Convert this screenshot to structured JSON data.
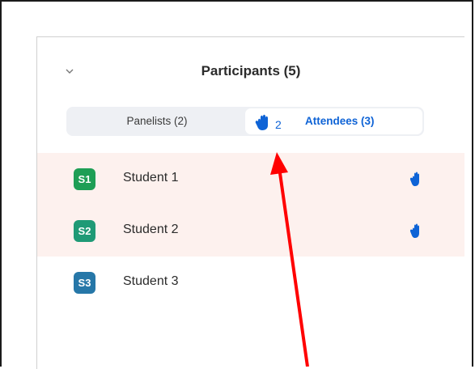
{
  "header": {
    "title": "Participants (5)",
    "collapse_icon": "chevron-down-icon"
  },
  "tabs": {
    "panelists": {
      "label": "Panelists (2)"
    },
    "attendees": {
      "label": "Attendees (3)",
      "raised_hands_count": "2",
      "icon": "raised-hand-icon"
    }
  },
  "attendees": [
    {
      "initials": "S1",
      "name": "Student 1",
      "avatar_color": "#1e9e55",
      "hand_raised": true
    },
    {
      "initials": "S2",
      "name": "Student 2",
      "avatar_color": "#1f9a76",
      "hand_raised": true
    },
    {
      "initials": "S3",
      "name": "Student 3",
      "avatar_color": "#2677a8",
      "hand_raised": false
    }
  ],
  "colors": {
    "accent": "#0e63d6",
    "raised_row_bg": "#fdf1ee",
    "annotation_arrow": "#ff0000"
  }
}
